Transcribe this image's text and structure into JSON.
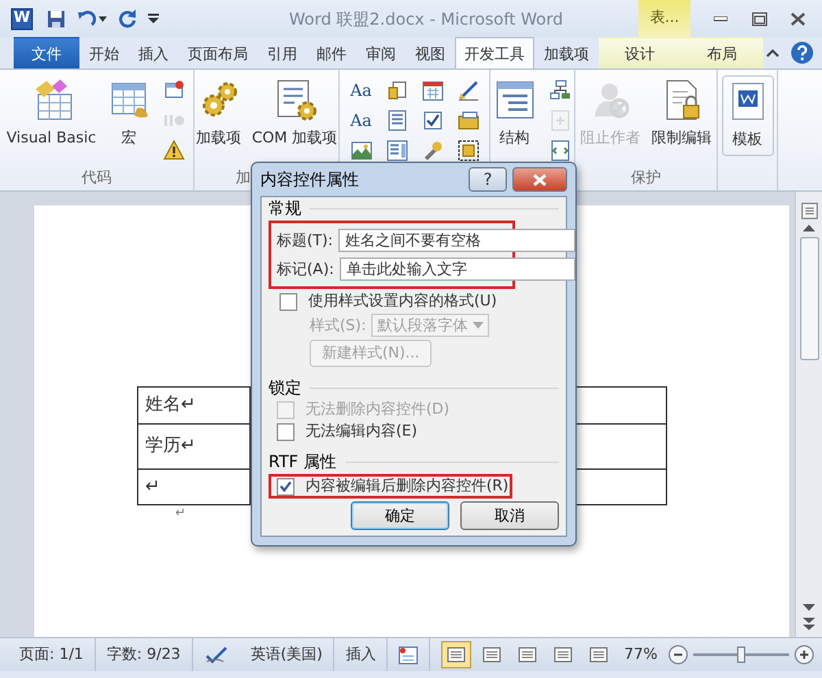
{
  "window": {
    "app_letter": "W",
    "title": "Word 联盟2.docx - Microsoft Word",
    "contextual_header": "表..."
  },
  "tabs": [
    {
      "label": "文件",
      "kind": "file",
      "selected": false
    },
    {
      "label": "开始",
      "kind": "normal",
      "selected": false
    },
    {
      "label": "插入",
      "kind": "normal",
      "selected": false
    },
    {
      "label": "页面布局",
      "kind": "normal",
      "selected": false
    },
    {
      "label": "引用",
      "kind": "normal",
      "selected": false
    },
    {
      "label": "邮件",
      "kind": "normal",
      "selected": false
    },
    {
      "label": "审阅",
      "kind": "normal",
      "selected": false
    },
    {
      "label": "视图",
      "kind": "normal",
      "selected": false
    },
    {
      "label": "开发工具",
      "kind": "normal",
      "selected": true
    },
    {
      "label": "加载项",
      "kind": "normal",
      "selected": false
    },
    {
      "label": "设计",
      "kind": "contextual",
      "selected": false
    },
    {
      "label": "布局",
      "kind": "contextual",
      "selected": false
    }
  ],
  "ribbon": {
    "groups": [
      {
        "label": "代码",
        "items": [
          {
            "kind": "large",
            "label": "Visual Basic",
            "disabled": false
          },
          {
            "kind": "large",
            "label": "宏",
            "disabled": false
          },
          {
            "kind": "small",
            "disabled": false
          },
          {
            "kind": "small",
            "disabled": true
          },
          {
            "kind": "small",
            "disabled": false
          }
        ]
      },
      {
        "label": "加",
        "items": [
          {
            "kind": "large",
            "label": "加载项",
            "disabled": false
          },
          {
            "kind": "large",
            "label": "COM 加载项",
            "disabled": false
          }
        ]
      },
      {
        "items": [
          {
            "kind": "small",
            "label": "Aa",
            "disabled": false
          },
          {
            "kind": "small",
            "label": "Aa",
            "disabled": false
          },
          {
            "kind": "small",
            "disabled": false
          },
          {
            "kind": "small",
            "disabled": false
          },
          {
            "kind": "small",
            "disabled": false
          },
          {
            "kind": "small",
            "disabled": false
          },
          {
            "kind": "small",
            "disabled": false
          },
          {
            "kind": "small",
            "disabled": false
          },
          {
            "kind": "small",
            "disabled": false
          },
          {
            "kind": "small",
            "disabled": false
          },
          {
            "kind": "small",
            "disabled": false
          },
          {
            "kind": "small",
            "disabled": false
          }
        ]
      },
      {
        "items": [
          {
            "kind": "large",
            "label": "结构",
            "disabled": false
          },
          {
            "kind": "small",
            "disabled": false
          },
          {
            "kind": "small",
            "disabled": true
          },
          {
            "kind": "small",
            "disabled": false
          }
        ]
      },
      {
        "label": "保护",
        "items": [
          {
            "kind": "large",
            "label": "阻止作者",
            "disabled": true
          },
          {
            "kind": "large",
            "label": "限制编辑",
            "disabled": false
          }
        ]
      },
      {
        "items": [
          {
            "kind": "large",
            "label": "模板",
            "disabled": false
          }
        ]
      }
    ]
  },
  "document": {
    "table_rows": [
      {
        "text": "姓名↵"
      },
      {
        "text": "学历↵"
      },
      {
        "text": "↵"
      }
    ],
    "after_table": "↵"
  },
  "dialog": {
    "title": "内容控件属性",
    "help": "?",
    "general": {
      "heading": "常规",
      "highlighted": true,
      "fields": [
        {
          "label": "标题(T):",
          "value": "姓名之间不要有空格"
        },
        {
          "label": "标记(A):",
          "value": "单击此处输入文字"
        }
      ],
      "style_checkbox": {
        "label": "使用样式设置内容的格式(U)",
        "checked": false
      },
      "style_select": {
        "label": "样式(S):",
        "value": "默认段落字体",
        "disabled": true
      },
      "new_style_button": {
        "label": "新建样式(N)...",
        "disabled": true
      }
    },
    "locking": {
      "heading": "锁定",
      "options": [
        {
          "label": "无法删除内容控件(D)",
          "checked": false,
          "disabled": true
        },
        {
          "label": "无法编辑内容(E)",
          "checked": false,
          "disabled": false
        }
      ]
    },
    "rtf": {
      "heading": "RTF 属性",
      "options": [
        {
          "label": "内容被编辑后删除内容控件(R)",
          "checked": true,
          "disabled": false,
          "highlighted": true
        }
      ]
    },
    "buttons": [
      {
        "label": "确定",
        "default": true
      },
      {
        "label": "取消",
        "default": false
      }
    ]
  },
  "status_bar": {
    "page": "页面: 1/1",
    "words": "字数: 9/23",
    "language": "英语(美国)",
    "mode": "插入",
    "views": [
      {
        "selected": true
      },
      {
        "selected": false
      },
      {
        "selected": false
      },
      {
        "selected": false
      },
      {
        "selected": false
      }
    ],
    "zoom": {
      "reading": "77%",
      "level": 0.5
    }
  }
}
